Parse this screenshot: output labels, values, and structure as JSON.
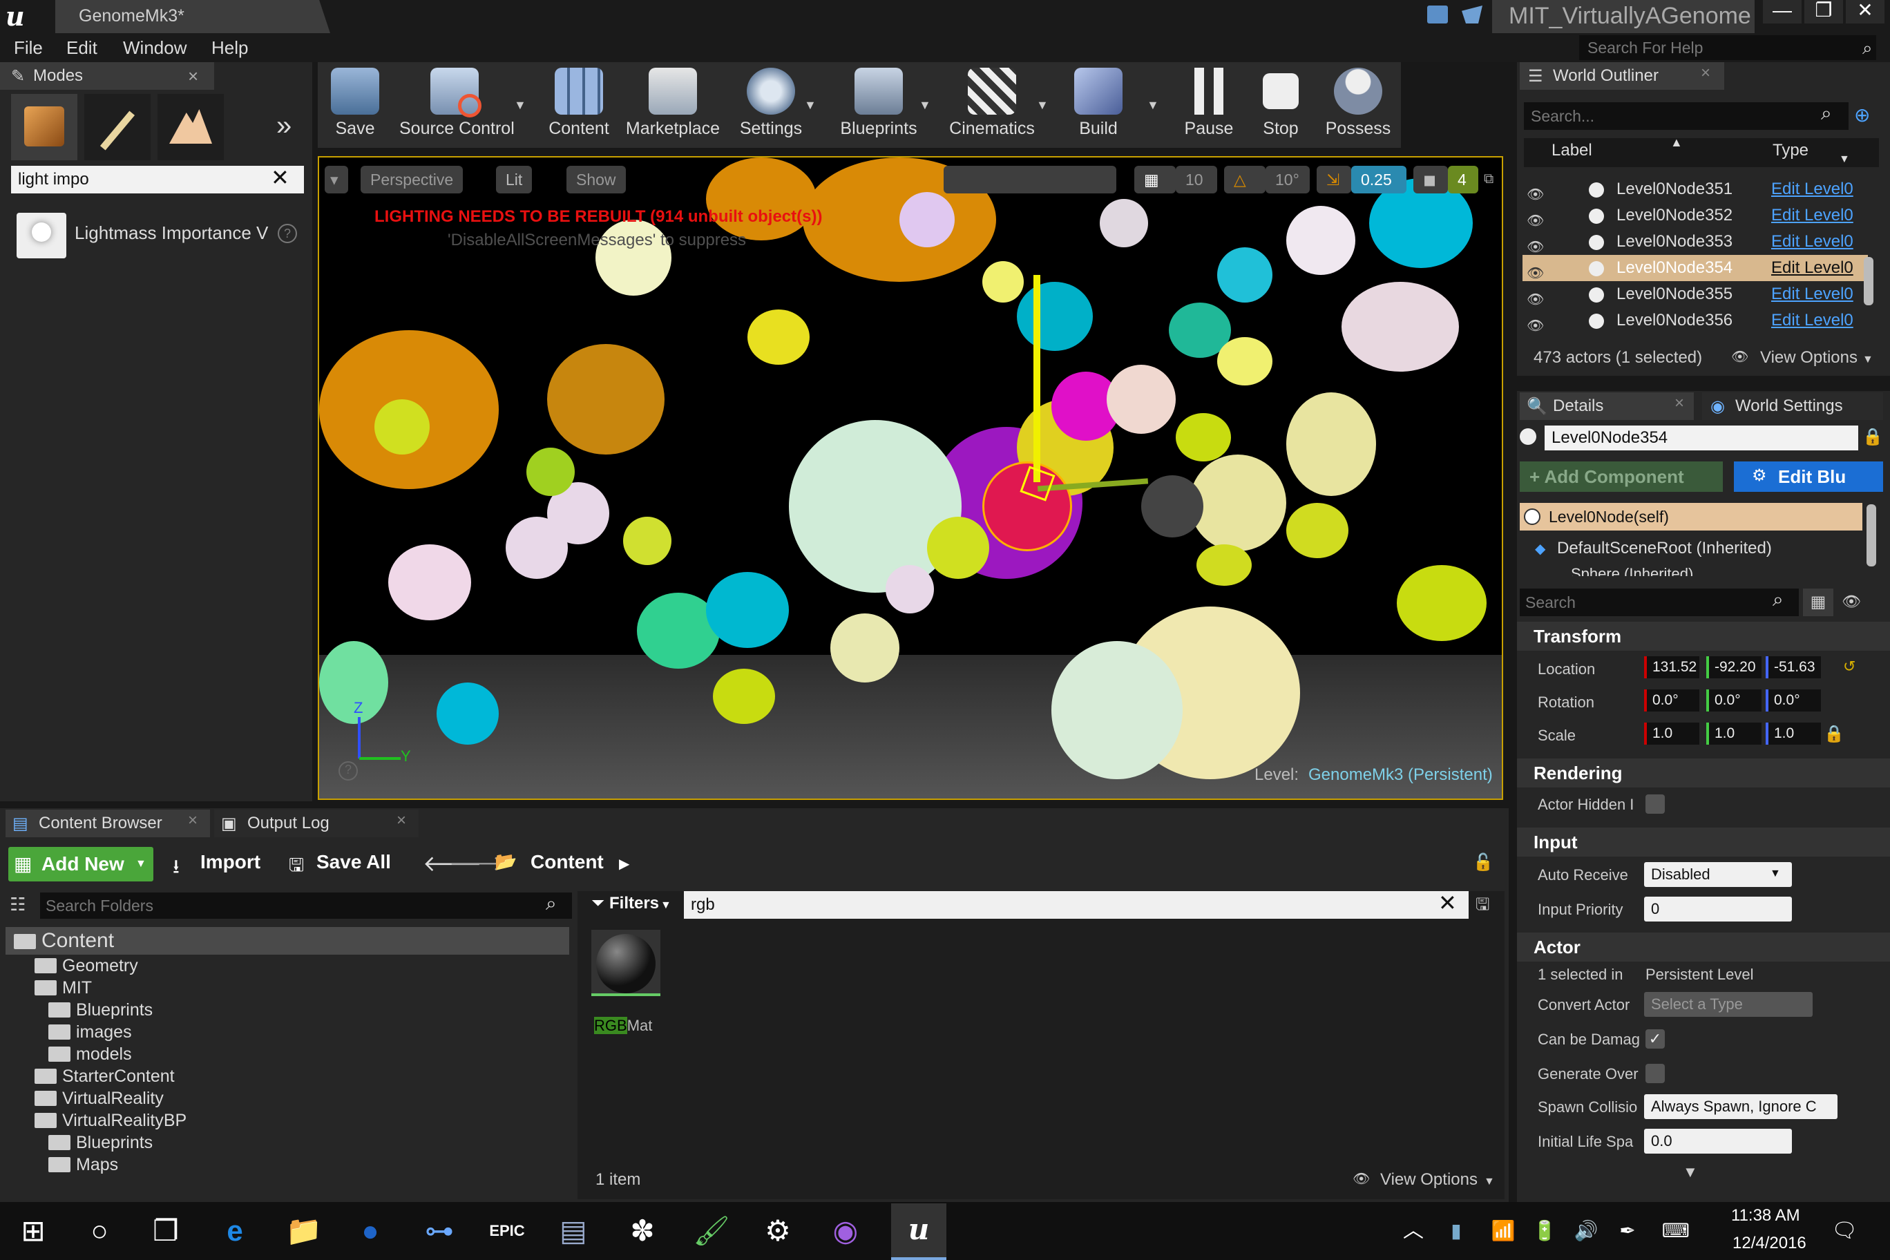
{
  "title_bar": {
    "doc_tab": "GenomeMk3*",
    "project": "MIT_VirtuallyAGenome",
    "window_buttons": [
      "—",
      "❐",
      "✕"
    ]
  },
  "menu": [
    "File",
    "Edit",
    "Window",
    "Help"
  ],
  "help_search_placeholder": "Search For Help",
  "modes": {
    "tab": "Modes",
    "search_value": "light impo",
    "result": "Lightmass Importance V"
  },
  "toolbar": {
    "buttons": [
      "Save",
      "Source Control",
      "Content",
      "Marketplace",
      "Settings",
      "Blueprints",
      "Cinematics",
      "Build",
      "Pause",
      "Stop",
      "Possess"
    ]
  },
  "viewport": {
    "view_mode": "Perspective",
    "lighting": "Lit",
    "show": "Show",
    "warning": "LIGHTING NEEDS TO BE REBUILT (914 unbuilt object(s))",
    "subwarning": "'DisableAllScreenMessages' to suppress",
    "grid_snap": "10",
    "rot_snap": "10°",
    "scale_snap": "0.25",
    "camera_speed": "4",
    "level_label": "Level:",
    "level_name": "GenomeMk3 (Persistent)",
    "axis_z": "Z",
    "axis_y": "Y"
  },
  "outliner": {
    "tab": "World Outliner",
    "search_placeholder": "Search...",
    "col_label": "Label",
    "col_type": "Type",
    "rows": [
      {
        "name": "Level0Node351",
        "type": "Edit Level0"
      },
      {
        "name": "Level0Node352",
        "type": "Edit Level0"
      },
      {
        "name": "Level0Node353",
        "type": "Edit Level0"
      },
      {
        "name": "Level0Node354",
        "type": "Edit Level0"
      },
      {
        "name": "Level0Node355",
        "type": "Edit Level0"
      },
      {
        "name": "Level0Node356",
        "type": "Edit Level0"
      }
    ],
    "status": "473 actors (1 selected)",
    "view_options": "View Options"
  },
  "details": {
    "tab": "Details",
    "tab2": "World Settings",
    "actor_name": "Level0Node354",
    "add_component": "+ Add Component",
    "edit_bp": "Edit Blu",
    "self_comp": "Level0Node(self)",
    "root_comp": "DefaultSceneRoot (Inherited)",
    "sub_comp": "Sphere (Inherited)",
    "search_placeholder": "Search",
    "transform": "Transform",
    "location": "Location",
    "rotation": "Rotation",
    "scale": "Scale",
    "loc_vals": [
      "131.52",
      "-92.20",
      "-51.63"
    ],
    "rot_vals": [
      "0.0°",
      "0.0°",
      "0.0°"
    ],
    "scale_vals": [
      "1.0",
      "1.0",
      "1.0"
    ],
    "rendering": "Rendering",
    "actor_hidden": "Actor Hidden I",
    "input": "Input",
    "auto_receive": "Auto Receive",
    "auto_receive_val": "Disabled",
    "input_priority": "Input Priority",
    "input_priority_val": "0",
    "actor": "Actor",
    "selected_in": "1 selected in",
    "selected_in_val": "Persistent Level",
    "convert_actor": "Convert Actor",
    "convert_actor_val": "Select a Type",
    "can_be_damaged": "Can be Damag",
    "generate_overlap": "Generate Over",
    "spawn_collision": "Spawn Collisio",
    "spawn_collision_val": "Always Spawn, Ignore C",
    "initial_life": "Initial Life Spa",
    "initial_life_val": "0.0"
  },
  "content_browser": {
    "tab": "Content Browser",
    "tab2": "Output Log",
    "add_new": "Add New",
    "import": "Import",
    "save_all": "Save All",
    "path": "Content",
    "search_folders": "Search Folders",
    "filters": "Filters",
    "search_value": "rgb",
    "folders": [
      {
        "name": "Content",
        "level": 0
      },
      {
        "name": "Geometry",
        "level": 1
      },
      {
        "name": "MIT",
        "level": 1
      },
      {
        "name": "Blueprints",
        "level": 2
      },
      {
        "name": "images",
        "level": 2
      },
      {
        "name": "models",
        "level": 2
      },
      {
        "name": "StarterContent",
        "level": 1
      },
      {
        "name": "VirtualReality",
        "level": 1
      },
      {
        "name": "VirtualRealityBP",
        "level": 1
      },
      {
        "name": "Blueprints",
        "level": 2
      },
      {
        "name": "Maps",
        "level": 2
      }
    ],
    "asset_highlight": "RGB",
    "asset_rest": "Mat",
    "item_count": "1 item",
    "view_options": "View Options"
  },
  "taskbar": {
    "time": "11:38 AM",
    "date": "12/4/2016"
  }
}
